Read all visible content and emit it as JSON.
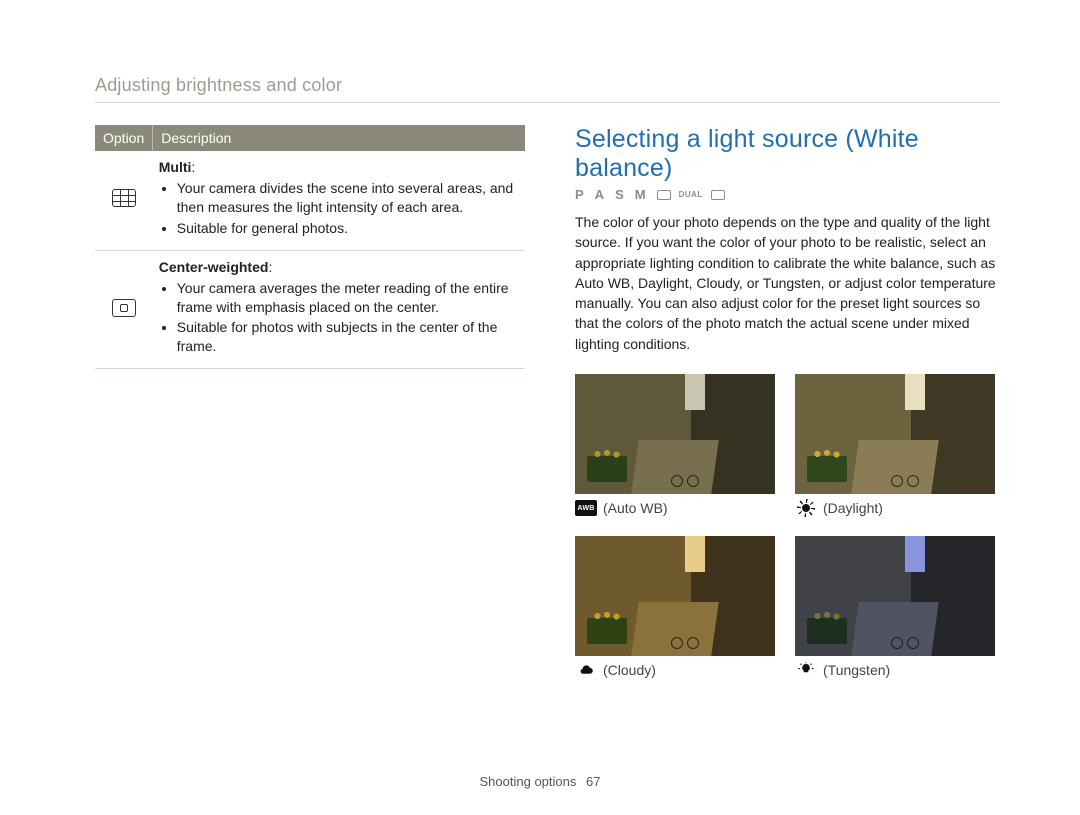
{
  "breadcrumb": "Adjusting brightness and color",
  "table": {
    "head_option": "Option",
    "head_desc": "Description",
    "rows": [
      {
        "title": "Multi",
        "b1": "Your camera divides the scene into several areas, and then measures the light intensity of each area.",
        "b2": "Suitable for general photos."
      },
      {
        "title": "Center-weighted",
        "b1": "Your camera averages the meter reading of the entire frame with emphasis placed on the center.",
        "b2": "Suitable for photos with subjects in the center of the frame."
      }
    ]
  },
  "section_title": "Selecting a light source (White balance)",
  "modes": {
    "p": "P",
    "a": "A",
    "s": "S",
    "m": "M",
    "dual": "DUAL"
  },
  "body": "The color of your photo depends on the type and quality of the light source. If you want the color of your photo to be realistic, select an appropriate lighting condition to calibrate the white balance, such as Auto WB, Daylight, Cloudy, or Tungsten, or adjust color temperature manually. You can also adjust color for the preset light sources so that the colors of the photo match the actual scene under mixed lighting conditions.",
  "wb": {
    "auto_icon": "AWB",
    "auto": "(Auto WB)",
    "day": "(Daylight)",
    "cloudy": "(Cloudy)",
    "tung": "(Tungsten)"
  },
  "footer": {
    "section": "Shooting options",
    "page": "67"
  }
}
